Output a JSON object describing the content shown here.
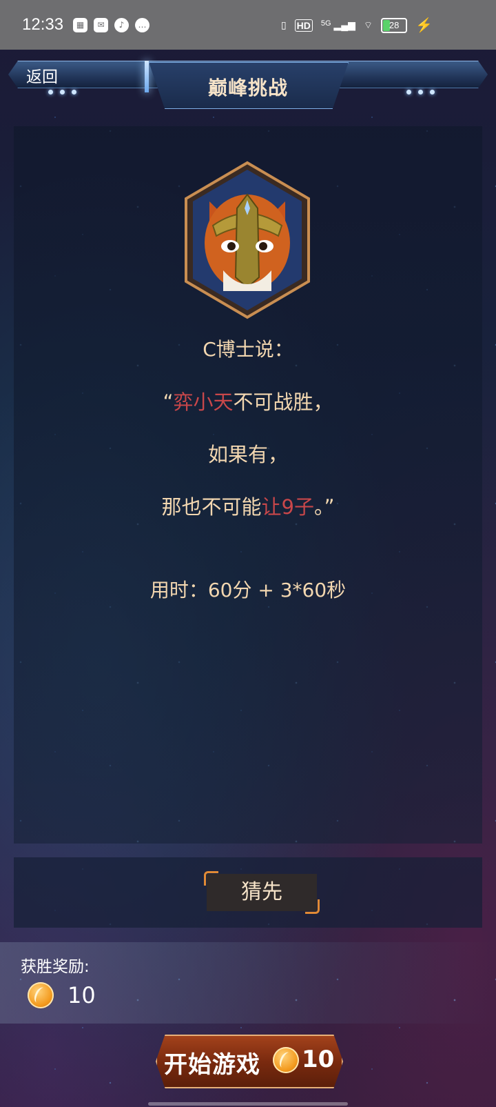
{
  "status_bar": {
    "time": "12:33",
    "network": "HD",
    "signal": "5G",
    "battery": "28"
  },
  "header": {
    "back_label": "返回",
    "title": "巅峰挑战"
  },
  "challenge": {
    "speaker": "C博士说：",
    "quote_open": "“",
    "quote_line1_highlight": "弈小天",
    "quote_line1_rest": "不可战胜，",
    "quote_line2": "如果有，",
    "quote_line3_prefix": "那也不可能",
    "quote_line3_highlight": "让9子",
    "quote_line3_suffix": "。”",
    "time_limit": "用时：60分 + 3*60秒"
  },
  "guess": {
    "label": "猜先"
  },
  "reward": {
    "label": "获胜奖励:",
    "amount": "10"
  },
  "start": {
    "label": "开始游戏",
    "cost": "10"
  },
  "colors": {
    "highlight": "#c9474a",
    "text_gold": "#f3d7b0",
    "accent_orange": "#e18a35"
  }
}
